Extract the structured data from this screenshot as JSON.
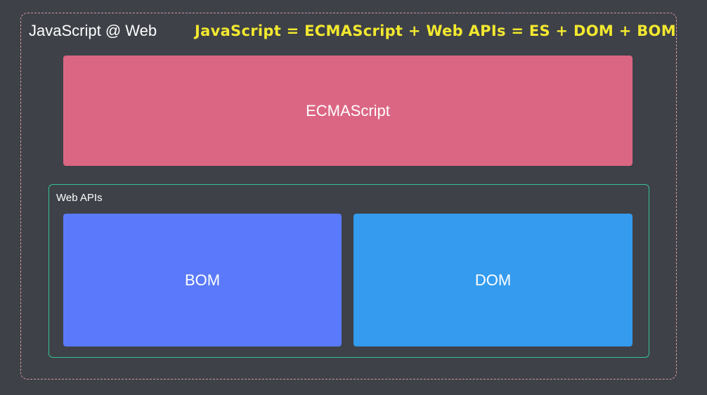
{
  "diagram": {
    "title": "JavaScript @ Web",
    "formula": "JavaScript = ECMAScript + Web APIs = ES + DOM + BOM",
    "ecmascript": {
      "label": "ECMAScript",
      "color": "#db6683"
    },
    "web_apis": {
      "label": "Web APIs",
      "border_color": "#34c393",
      "bom": {
        "label": "BOM",
        "color": "#5a7afb"
      },
      "dom": {
        "label": "DOM",
        "color": "#349bef"
      }
    },
    "frame_border_color": "#d59a9f",
    "formula_color": "#f2e82f",
    "background_color": "#3e4148"
  }
}
